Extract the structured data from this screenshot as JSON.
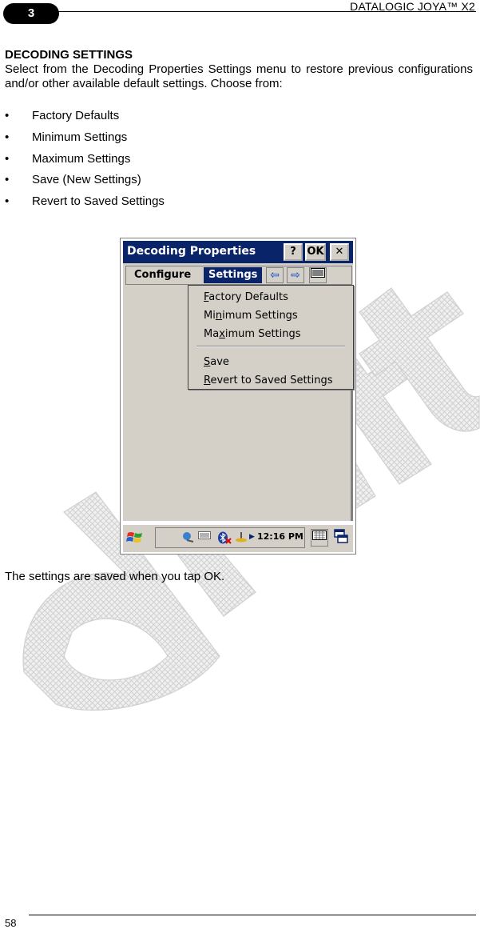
{
  "header": {
    "chapter": "3",
    "doc_title": "DATALOGIC JOYA™ X2"
  },
  "section_title": "DECODING SETTINGS",
  "intro": "Select from the Decoding Properties Settings menu to restore previous configurations and/or other available default settings. Choose from:",
  "bullets": [
    "Factory Defaults",
    "Minimum Settings",
    "Maximum Settings",
    "Save (New Settings)",
    "Revert to Saved Settings"
  ],
  "bullet_symbol": "•",
  "screenshot": {
    "window_title": "Decoding Properties",
    "help_label": "?",
    "ok_label": "OK",
    "close_label": "✕",
    "menu": {
      "configure": "Configure",
      "settings": "Settings"
    },
    "toolbar": {
      "back_icon": "⇦",
      "forward_icon": "⇨",
      "keyboard_icon": "▥"
    },
    "dropdown": {
      "items": [
        {
          "pre": "",
          "accel": "F",
          "post": "actory Defaults"
        },
        {
          "pre": "Mi",
          "accel": "n",
          "post": "imum Settings"
        },
        {
          "pre": "Ma",
          "accel": "x",
          "post": "imum Settings"
        },
        {
          "pre": "",
          "accel": "S",
          "post": "ave"
        },
        {
          "pre": "",
          "accel": "R",
          "post": "evert to Saved Settings"
        }
      ]
    },
    "taskbar": {
      "clock": "12:16 PM"
    }
  },
  "closing": "The settings are saved when you tap OK.",
  "footer": {
    "page_number": "58"
  },
  "colors": {
    "titlebar": "#0a246a",
    "menu_face": "#d4d0c8",
    "watermark": "#c8c8c8"
  }
}
